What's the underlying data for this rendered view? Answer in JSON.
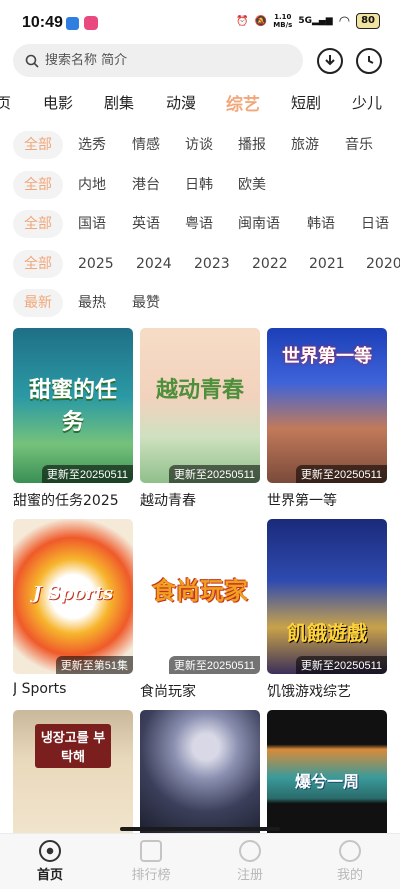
{
  "status_bar": {
    "time": "10:49",
    "net_speed_value": "1.10",
    "net_speed_unit": "MB/s",
    "signal": "5G",
    "battery": "80"
  },
  "search": {
    "placeholder": "搜索名称 简介"
  },
  "categories": [
    "页",
    "电影",
    "剧集",
    "动漫",
    "综艺",
    "短剧",
    "少儿"
  ],
  "active_category": "综艺",
  "filters": {
    "type": [
      "全部",
      "选秀",
      "情感",
      "访谈",
      "播报",
      "旅游",
      "音乐"
    ],
    "region": [
      "全部",
      "内地",
      "港台",
      "日韩",
      "欧美"
    ],
    "language": [
      "全部",
      "国语",
      "英语",
      "粤语",
      "闽南语",
      "韩语",
      "日语"
    ],
    "year": [
      "全部",
      "2025",
      "2024",
      "2023",
      "2022",
      "2021",
      "2020"
    ],
    "sort": [
      "最新",
      "最热",
      "最赞"
    ]
  },
  "cards": [
    {
      "title": "甜蜜的任务2025",
      "badge": "更新至20250511",
      "art_text": "甜蜜的任务"
    },
    {
      "title": "越动青春",
      "badge": "更新至20250511",
      "art_text": "越动青春"
    },
    {
      "title": "世界第一等",
      "badge": "更新至20250511",
      "art_text": "世界第一等"
    },
    {
      "title": "J Sports",
      "badge": "更新至第51集",
      "art_text": "J Sports"
    },
    {
      "title": "食尚玩家",
      "badge": "更新至20250511",
      "art_text": "食尚玩家"
    },
    {
      "title": "饥饿游戏综艺",
      "badge": "更新至20250511",
      "art_text": "飢餓遊戲"
    },
    {
      "title": "",
      "badge": "",
      "art_text": "냉장고를 부탁해"
    },
    {
      "title": "",
      "badge": "",
      "art_text": ""
    },
    {
      "title": "",
      "badge": "",
      "art_text": "爆兮一周"
    }
  ],
  "bottom_nav": [
    "首页",
    "排行榜",
    "注册",
    "我的"
  ],
  "colors": {
    "accent": "#f2a77a",
    "chip_bg": "#f3f3f3",
    "nav_inactive": "#b8b8b8"
  }
}
